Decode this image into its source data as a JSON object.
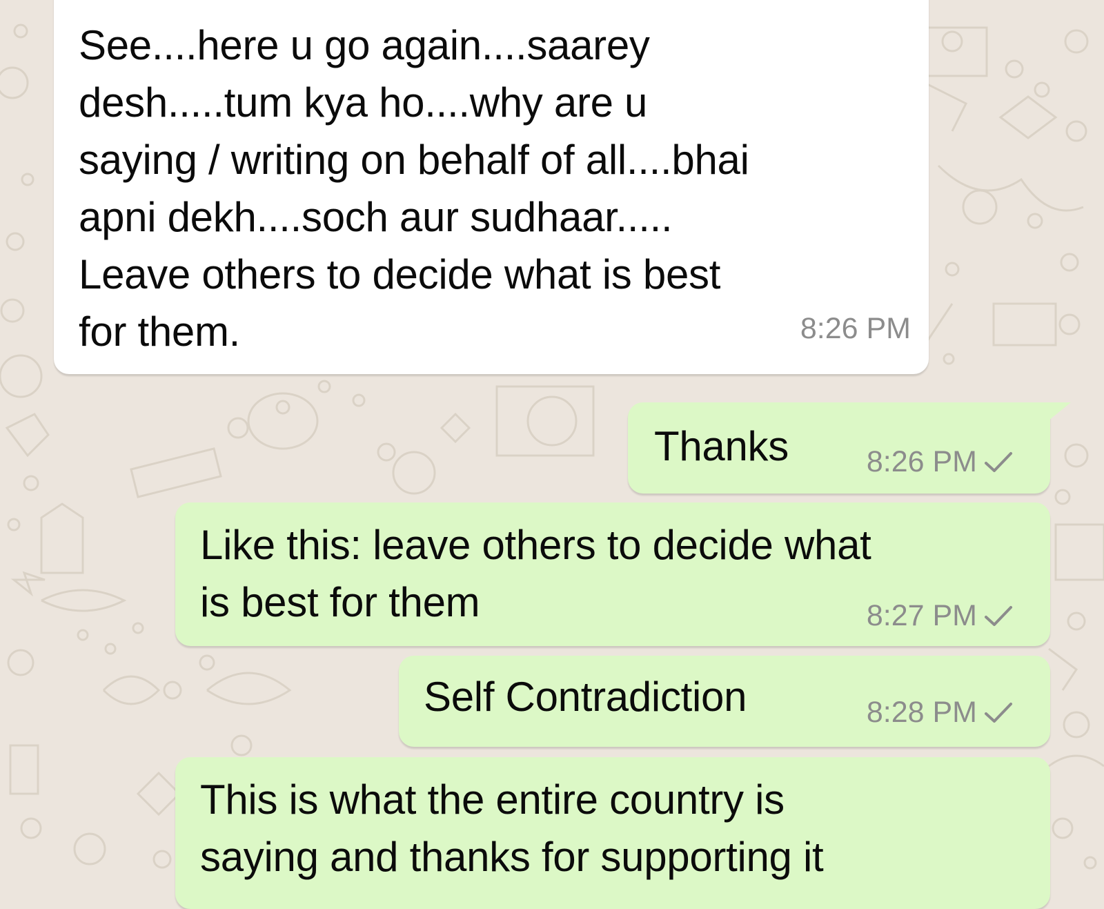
{
  "theme": {
    "background": "#ece5dd",
    "incoming_bubble": "#ffffff",
    "outgoing_bubble": "#dcf8c6",
    "timestamp_color": "#8c8c8c",
    "tick_color": "#8c8c8c"
  },
  "messages": [
    {
      "direction": "incoming",
      "text": "See....here u go again....saarey\ndesh.....tum kya ho....why are u\nsaying / writing on behalf of all....bhai\napni dekh....soch aur sudhaar.....\nLeave others to decide what is best\nfor them.",
      "time": "8:26 PM"
    },
    {
      "direction": "outgoing",
      "text": "Thanks",
      "time": "8:26 PM",
      "status_icon": "single-check-icon"
    },
    {
      "direction": "outgoing",
      "text": "Like this: leave others to decide what\nis best for them",
      "time": "8:27 PM",
      "status_icon": "single-check-icon"
    },
    {
      "direction": "outgoing",
      "text": "Self Contradiction",
      "time": "8:28 PM",
      "status_icon": "single-check-icon"
    },
    {
      "direction": "outgoing",
      "text": "This is what the entire country is\nsaying and thanks for supporting it"
    }
  ]
}
